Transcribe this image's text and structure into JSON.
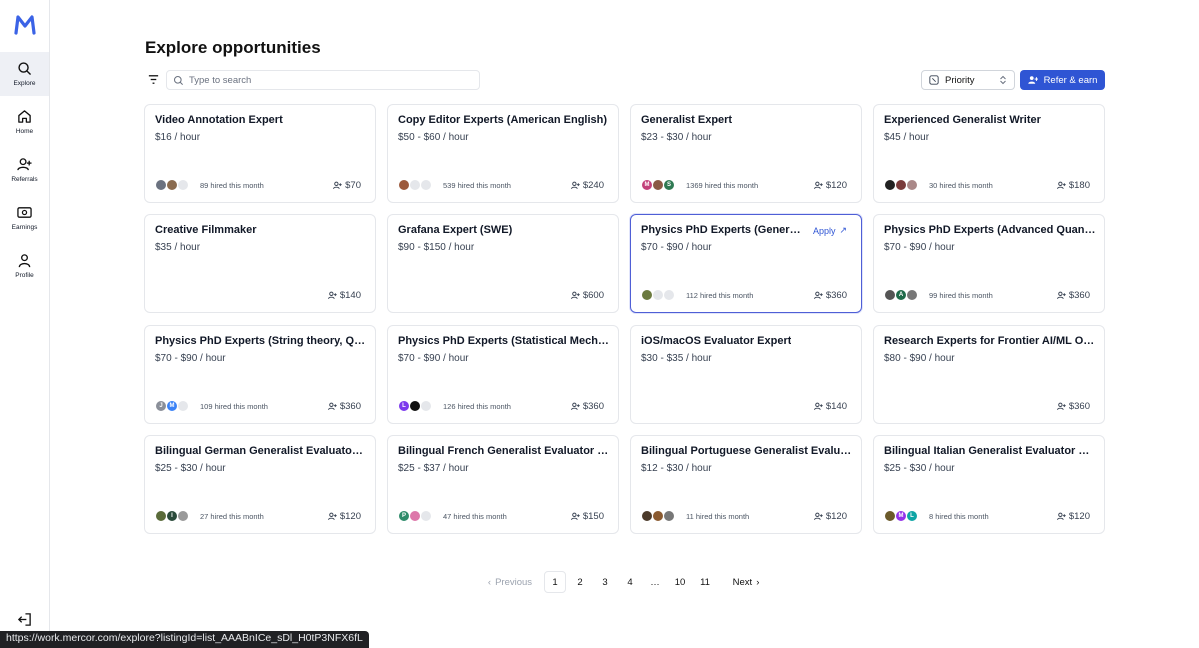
{
  "sidebar": {
    "items": [
      {
        "label": "Explore"
      },
      {
        "label": "Home"
      },
      {
        "label": "Referrals"
      },
      {
        "label": "Earnings"
      },
      {
        "label": "Profile"
      }
    ]
  },
  "page": {
    "title": "Explore opportunities"
  },
  "search": {
    "placeholder": "Type to search"
  },
  "sort": {
    "label": "Priority"
  },
  "refer_button": {
    "label": "Refer & earn"
  },
  "cards": [
    {
      "title": "Video Annotation Expert",
      "rate": "$16 / hour",
      "hired": "89 hired this month",
      "referral": "$70"
    },
    {
      "title": "Copy Editor Experts (American English)",
      "rate": "$50 - $60 / hour",
      "hired": "539 hired this month",
      "referral": "$240"
    },
    {
      "title": "Generalist Expert",
      "rate": "$23 - $30 / hour",
      "hired": "1369 hired this month",
      "referral": "$120"
    },
    {
      "title": "Experienced Generalist Writer",
      "rate": "$45 / hour",
      "hired": "30 hired this month",
      "referral": "$180"
    },
    {
      "title": "Creative Filmmaker",
      "rate": "$35 / hour",
      "hired": "",
      "referral": "$140"
    },
    {
      "title": "Grafana Expert (SWE)",
      "rate": "$90 - $150 / hour",
      "hired": "",
      "referral": "$600"
    },
    {
      "title": "Physics PhD Experts (General Re...",
      "rate": "$70 - $90 / hour",
      "hired": "112 hired this month",
      "referral": "$360",
      "apply": "Apply"
    },
    {
      "title": "Physics PhD Experts (Advanced Quantum,...",
      "rate": "$70 - $90 / hour",
      "hired": "99 hired this month",
      "referral": "$360"
    },
    {
      "title": "Physics PhD Experts (String theory, QFT, P...",
      "rate": "$70 - $90 / hour",
      "hired": "109 hired this month",
      "referral": "$360"
    },
    {
      "title": "Physics PhD Experts (Statistical Mechanic...",
      "rate": "$70 - $90 / hour",
      "hired": "126 hired this month",
      "referral": "$360"
    },
    {
      "title": "iOS/macOS Evaluator Expert",
      "rate": "$30 - $35 / hour",
      "hired": "",
      "referral": "$140"
    },
    {
      "title": "Research Experts for Frontier AI/ML Open ...",
      "rate": "$80 - $90 / hour",
      "hired": "",
      "referral": "$360"
    },
    {
      "title": "Bilingual German Generalist Evaluator Exp...",
      "rate": "$25 - $30 / hour",
      "hired": "27 hired this month",
      "referral": "$120"
    },
    {
      "title": "Bilingual French Generalist Evaluator Expert",
      "rate": "$25 - $37 / hour",
      "hired": "47 hired this month",
      "referral": "$150"
    },
    {
      "title": "Bilingual Portuguese Generalist Evaluator ...",
      "rate": "$12 - $30 / hour",
      "hired": "11 hired this month",
      "referral": "$120"
    },
    {
      "title": "Bilingual Italian Generalist Evaluator Expert",
      "rate": "$25 - $30 / hour",
      "hired": "8 hired this month",
      "referral": "$120"
    }
  ],
  "pagination": {
    "previous": "Previous",
    "next": "Next",
    "pages": [
      "1",
      "2",
      "3",
      "4",
      "…",
      "10",
      "11"
    ],
    "current": "1"
  },
  "status_url": "https://work.mercor.com/explore?listingId=list_AAABnICe_sDl_H0tP3NFX6fL",
  "colors": {
    "accent": "#2f55d4",
    "active_border": "#4f5fd6"
  }
}
